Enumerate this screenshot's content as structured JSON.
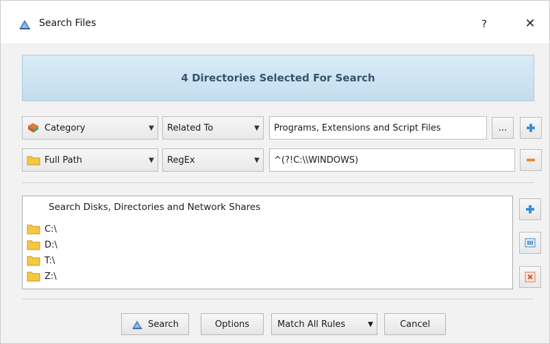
{
  "window": {
    "title": "Search Files",
    "help_label": "?",
    "close_label": "✕"
  },
  "banner": {
    "text": "4 Directories Selected For Search"
  },
  "rules": [
    {
      "field": "Category",
      "field_icon": "category-icon",
      "operator": "Related To",
      "value": "Programs, Extensions and Script Files",
      "browse_label": "...",
      "action_icon": "plus-icon"
    },
    {
      "field": "Full Path",
      "field_icon": "folder-icon",
      "operator": "RegEx",
      "value": "^(?!C:\\\\WINDOWS)",
      "action_icon": "minus-icon"
    }
  ],
  "locations": {
    "header": "Search Disks, Directories and Network Shares",
    "items": [
      "C:\\",
      "D:\\",
      "T:\\",
      "Z:\\"
    ],
    "side_buttons": [
      "plus-icon",
      "columns-icon",
      "remove-icon"
    ]
  },
  "footer": {
    "search_label": "Search",
    "options_label": "Options",
    "match_label": "Match All Rules",
    "cancel_label": "Cancel"
  },
  "colors": {
    "banner_bg": "#c9e1f0",
    "banner_text": "#35536c",
    "folder": "#f5c842",
    "accent_plus": "#3a8fd6",
    "accent_minus": "#e8893a"
  }
}
